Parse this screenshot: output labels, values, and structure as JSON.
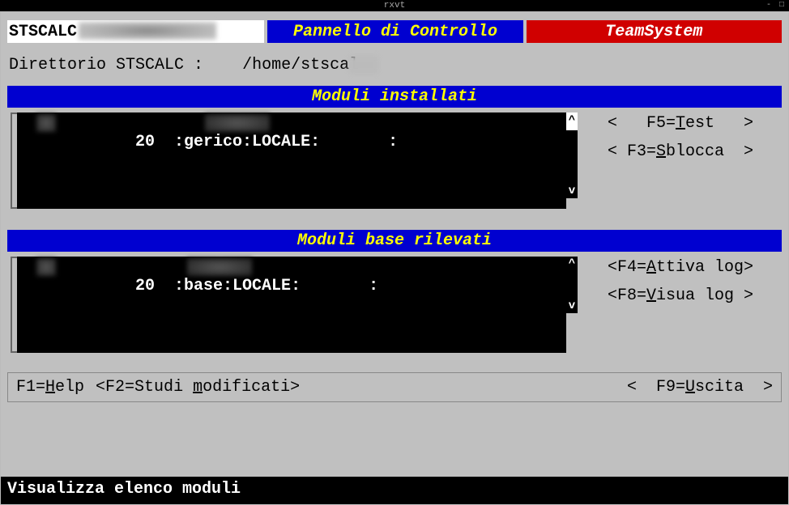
{
  "window": {
    "title": "rxvt",
    "controls": "- □"
  },
  "header": {
    "left": "STSCALC",
    "center": "Pannello di Controllo",
    "right": "TeamSystem"
  },
  "directory": {
    "label": "Direttorio STSCALC :",
    "value": "/home/stscal"
  },
  "sections": {
    "installed": {
      "title": "Moduli installati",
      "row": "20  :gerico:LOCALE:       :",
      "buttons": {
        "test": {
          "open": "<   F5=",
          "ul": "T",
          "rest": "est   >"
        },
        "sblocca": {
          "open": "< F3=",
          "ul": "S",
          "rest": "blocca  >"
        }
      }
    },
    "detected": {
      "title": "Moduli base rilevati",
      "row": "20  :base:LOCALE:       :",
      "buttons": {
        "attiva": {
          "open": "<F4=",
          "ul": "A",
          "rest": "ttiva log>"
        },
        "visua": {
          "open": "<F8=",
          "ul": "V",
          "rest": "isua log >"
        }
      }
    }
  },
  "bottom": {
    "help": {
      "pre": "F1=",
      "ul": "H",
      "rest": "elp"
    },
    "studi": {
      "open": "<F2=Studi ",
      "ul": "m",
      "rest": "odificati>"
    },
    "uscita": {
      "open": "<  F9=",
      "ul": "U",
      "rest": "scita  >"
    }
  },
  "status": "Visualizza elenco moduli",
  "scroll": {
    "up": "^",
    "down": "v"
  }
}
